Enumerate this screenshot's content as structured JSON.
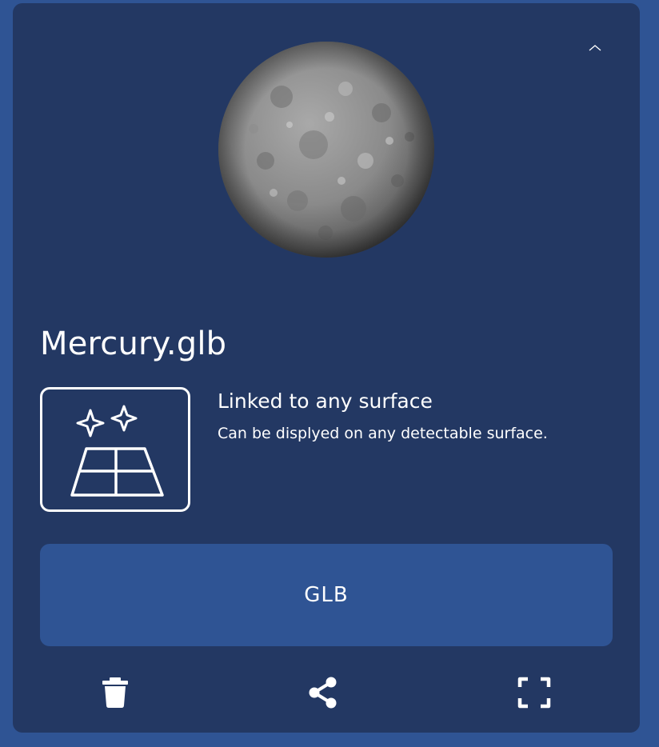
{
  "model": {
    "file_name": "Mercury.glb",
    "preview_alt": "Mercury planet 3D preview"
  },
  "placement": {
    "icon": "ar-surface-sparkles-icon",
    "heading": "Linked to any surface",
    "description": "Can be displyed on any detectable surface."
  },
  "format_button": {
    "label": "GLB"
  },
  "actions": [
    {
      "icon": "trash-icon",
      "label": "Delete"
    },
    {
      "icon": "share-icon",
      "label": "Share"
    },
    {
      "icon": "fullscreen-icon",
      "label": "Fullscreen"
    }
  ],
  "colors": {
    "page_background": "#2f5494",
    "card_background": "#233863",
    "button_background": "#2f5494",
    "text": "#ffffff"
  }
}
